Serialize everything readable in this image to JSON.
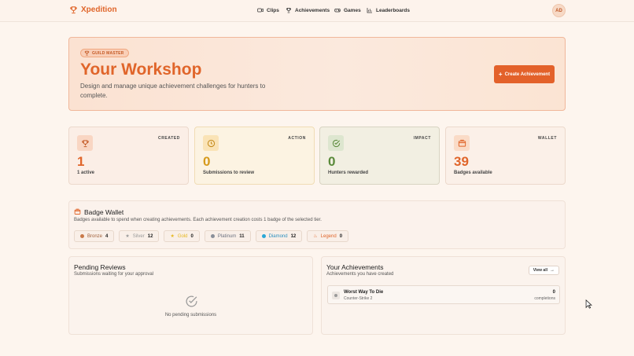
{
  "brand": {
    "name": "Xpedition",
    "accent": "#e0652a"
  },
  "nav": [
    {
      "label": "Clips",
      "icon": "video-icon"
    },
    {
      "label": "Achievements",
      "icon": "trophy-icon"
    },
    {
      "label": "Games",
      "icon": "gamepad-icon"
    },
    {
      "label": "Leaderboards",
      "icon": "chart-icon"
    }
  ],
  "user": {
    "initials": "AD"
  },
  "hero": {
    "badge": "GUILD MASTER",
    "title": "Your Workshop",
    "description": "Design and manage unique achievement challenges for hunters to complete.",
    "create_button": "Create Achievement"
  },
  "stats": [
    {
      "tag": "CREATED",
      "value": "1",
      "label": "1 active",
      "icon": "trophy-icon"
    },
    {
      "tag": "ACTION",
      "value": "0",
      "label": "Submissions to review",
      "icon": "clock-icon"
    },
    {
      "tag": "IMPACT",
      "value": "0",
      "label": "Hunters rewarded",
      "icon": "check-circle-icon"
    },
    {
      "tag": "WALLET",
      "value": "39",
      "label": "Badges available",
      "icon": "wallet-icon"
    }
  ],
  "badge_wallet": {
    "title": "Badge Wallet",
    "description": "Badges available to spend when creating achievements. Each achievement creation costs 1 badge of the selected tier.",
    "tiers": [
      {
        "name": "Bronze",
        "count": "4",
        "color": "#c97a4a"
      },
      {
        "name": "Silver",
        "count": "12",
        "color": "#9a9a9a"
      },
      {
        "name": "Gold",
        "count": "0",
        "color": "#e6b820"
      },
      {
        "name": "Platinum",
        "count": "11",
        "color": "#8a8f99"
      },
      {
        "name": "Diamond",
        "count": "12",
        "color": "#2aa7d6"
      },
      {
        "name": "Legend",
        "count": "0",
        "color": "#e0652a"
      }
    ]
  },
  "pending": {
    "title": "Pending Reviews",
    "subtitle": "Submissions waiting for your approval",
    "empty": "No pending submissions"
  },
  "your_achievements": {
    "title": "Your Achievements",
    "subtitle": "Achievements you have created",
    "view_all": "View all",
    "items": [
      {
        "title": "Worst Way To Die",
        "game": "Counter-Strike 2",
        "count": "0",
        "count_label": "completions"
      }
    ]
  }
}
